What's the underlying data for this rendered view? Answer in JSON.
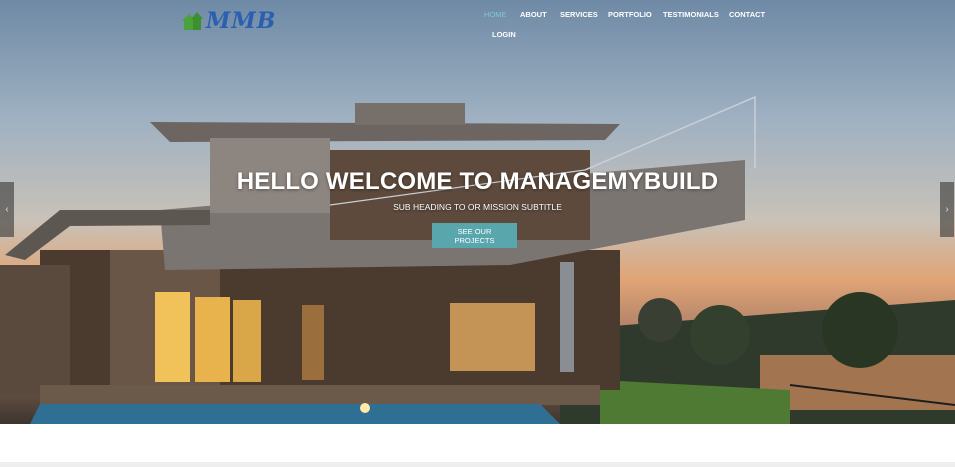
{
  "brand": {
    "logo_text": "MMB",
    "icon": "house-icon",
    "color": "#2b5fb0"
  },
  "nav": {
    "items": [
      "HOME",
      "ABOUT",
      "SERVICES",
      "PORTFOLIO",
      "TESTIMONIALS",
      "CONTACT",
      "LOGIN"
    ],
    "active": "HOME",
    "active_color": "#7ec8d8"
  },
  "hero": {
    "title": "HELLO WELCOME TO MANAGEMYBUILD",
    "subtitle": "SUB HEADING TO OR MISSION SUBTITLE",
    "cta_label": "SEE OUR PROJECTS",
    "cta_color": "#5aa6ad",
    "prev_icon": "chevron-left-icon",
    "next_icon": "chevron-right-icon",
    "prev_glyph": "‹",
    "next_glyph": "›"
  }
}
